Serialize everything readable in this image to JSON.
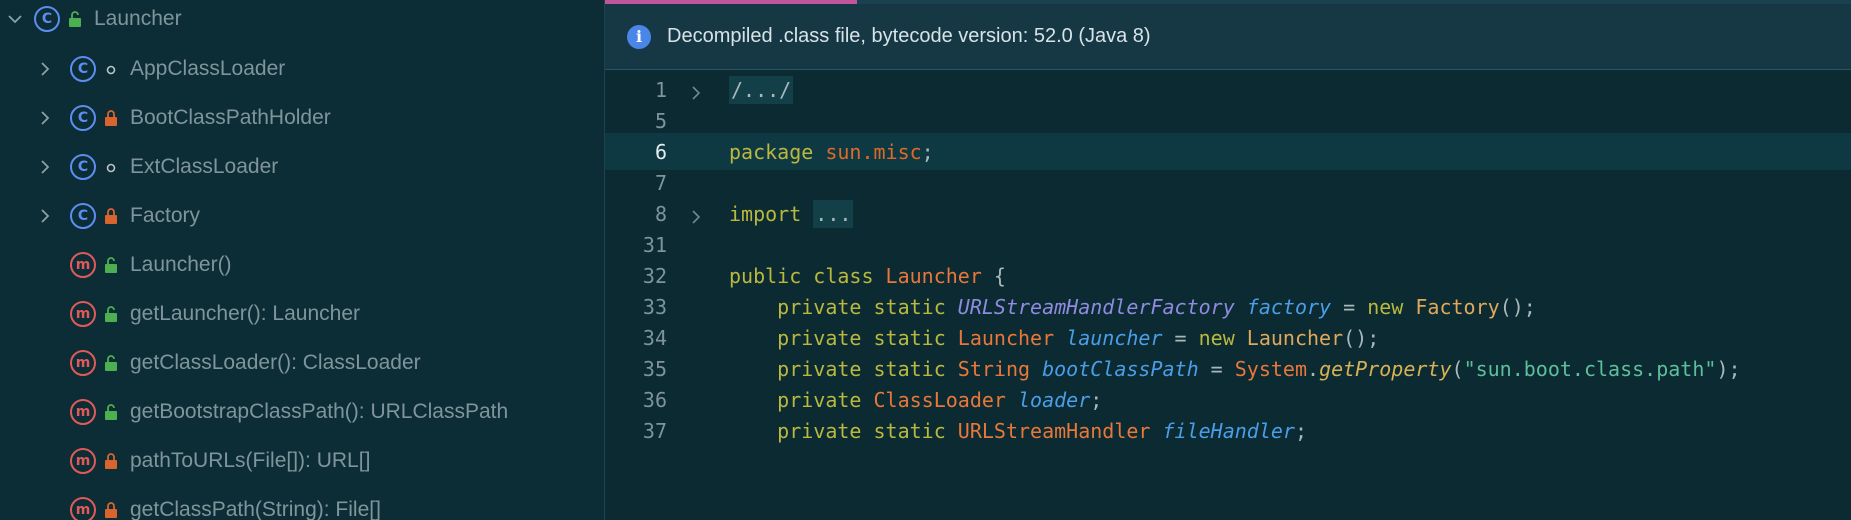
{
  "structure": {
    "root": {
      "name": "Launcher",
      "icon": "C",
      "visibility": "public"
    },
    "items": [
      {
        "name": "AppClassLoader",
        "kind": "class",
        "icon": "C",
        "visibility": "package",
        "expandable": true
      },
      {
        "name": "BootClassPathHolder",
        "kind": "class",
        "icon": "C",
        "visibility": "private",
        "expandable": true
      },
      {
        "name": "ExtClassLoader",
        "kind": "class",
        "icon": "C",
        "visibility": "package",
        "expandable": true
      },
      {
        "name": "Factory",
        "kind": "class",
        "icon": "C",
        "visibility": "private",
        "expandable": true
      },
      {
        "name": "Launcher()",
        "kind": "method",
        "icon": "m",
        "visibility": "public",
        "expandable": false
      },
      {
        "name": "getLauncher(): Launcher",
        "kind": "method",
        "icon": "m",
        "visibility": "public",
        "expandable": false
      },
      {
        "name": "getClassLoader(): ClassLoader",
        "kind": "method",
        "icon": "m",
        "visibility": "public",
        "expandable": false
      },
      {
        "name": "getBootstrapClassPath(): URLClassPath",
        "kind": "method",
        "icon": "m",
        "visibility": "public",
        "expandable": false
      },
      {
        "name": "pathToURLs(File[]): URL[]",
        "kind": "method",
        "icon": "m",
        "visibility": "private",
        "expandable": false
      },
      {
        "name": "getClassPath(String): File[]",
        "kind": "method",
        "icon": "m",
        "visibility": "private",
        "expandable": false
      }
    ]
  },
  "banner": {
    "text": "Decompiled .class file, bytecode version: 52.0 (Java 8)",
    "icon": "info-icon"
  },
  "editor": {
    "current_line": "6",
    "lines": [
      {
        "n": "1",
        "fold": true,
        "tokens": [
          [
            "fold-box",
            "/.../"
          ]
        ]
      },
      {
        "n": "5",
        "fold": false,
        "tokens": []
      },
      {
        "n": "6",
        "fold": false,
        "tokens": [
          [
            "kw",
            "package"
          ],
          [
            "pun",
            " "
          ],
          [
            "pkg",
            "sun.misc"
          ],
          [
            "pun",
            ";"
          ]
        ]
      },
      {
        "n": "7",
        "fold": false,
        "tokens": []
      },
      {
        "n": "8",
        "fold": true,
        "tokens": [
          [
            "kw",
            "import"
          ],
          [
            "pun",
            " "
          ],
          [
            "fold-box",
            "..."
          ]
        ]
      },
      {
        "n": "31",
        "fold": false,
        "tokens": []
      },
      {
        "n": "32",
        "fold": false,
        "tokens": [
          [
            "kw",
            "public class"
          ],
          [
            "pun",
            " "
          ],
          [
            "tyo",
            "Launcher"
          ],
          [
            "pun",
            " {"
          ]
        ]
      },
      {
        "n": "33",
        "fold": false,
        "tokens": [
          [
            "pun",
            "    "
          ],
          [
            "kw",
            "private static"
          ],
          [
            "pun",
            " "
          ],
          [
            "typ",
            "URLStreamHandlerFactory"
          ],
          [
            "pun",
            " "
          ],
          [
            "fld",
            "factory"
          ],
          [
            "pun",
            " = "
          ],
          [
            "kw",
            "new"
          ],
          [
            "pun",
            " "
          ],
          [
            "cls",
            "Factory"
          ],
          [
            "pun",
            "();"
          ]
        ]
      },
      {
        "n": "34",
        "fold": false,
        "tokens": [
          [
            "pun",
            "    "
          ],
          [
            "kw",
            "private static"
          ],
          [
            "pun",
            " "
          ],
          [
            "tyo",
            "Launcher"
          ],
          [
            "pun",
            " "
          ],
          [
            "fld",
            "launcher"
          ],
          [
            "pun",
            " = "
          ],
          [
            "kw",
            "new"
          ],
          [
            "pun",
            " "
          ],
          [
            "cls",
            "Launcher"
          ],
          [
            "pun",
            "();"
          ]
        ]
      },
      {
        "n": "35",
        "fold": false,
        "tokens": [
          [
            "pun",
            "    "
          ],
          [
            "kw",
            "private static"
          ],
          [
            "pun",
            " "
          ],
          [
            "tyo",
            "String"
          ],
          [
            "pun",
            " "
          ],
          [
            "fld",
            "bootClassPath"
          ],
          [
            "pun",
            " = "
          ],
          [
            "tyo",
            "System"
          ],
          [
            "pun",
            "."
          ],
          [
            "mth",
            "getProperty"
          ],
          [
            "pun",
            "("
          ],
          [
            "str",
            "\"sun.boot.class.path\""
          ],
          [
            "pun",
            ");"
          ]
        ]
      },
      {
        "n": "36",
        "fold": false,
        "tokens": [
          [
            "pun",
            "    "
          ],
          [
            "kw",
            "private"
          ],
          [
            "pun",
            " "
          ],
          [
            "tyo",
            "ClassLoader"
          ],
          [
            "pun",
            " "
          ],
          [
            "fld",
            "loader"
          ],
          [
            "pun",
            ";"
          ]
        ]
      },
      {
        "n": "37",
        "fold": false,
        "tokens": [
          [
            "pun",
            "    "
          ],
          [
            "kw",
            "private static"
          ],
          [
            "pun",
            " "
          ],
          [
            "tyo",
            "URLStreamHandler"
          ],
          [
            "pun",
            " "
          ],
          [
            "fld",
            "fileHandler"
          ],
          [
            "pun",
            ";"
          ]
        ]
      }
    ]
  },
  "colors": {
    "background": "#0b2b33",
    "accent_tab": "#c0559b",
    "keyword": "#b9b83f",
    "string": "#5dbf9c"
  }
}
